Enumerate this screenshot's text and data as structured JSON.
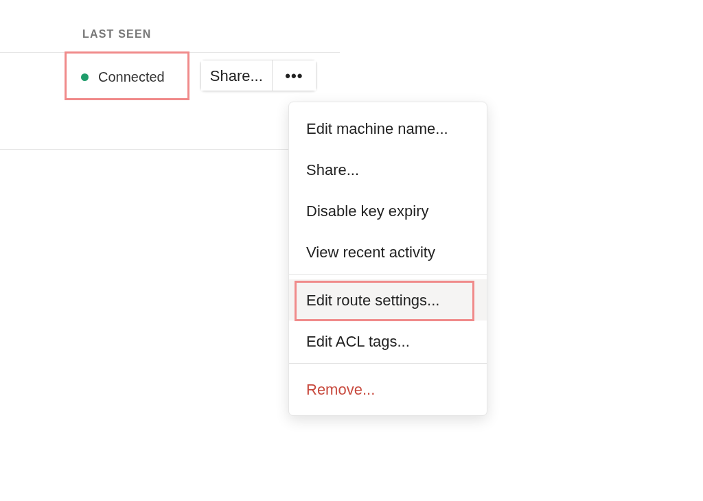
{
  "table": {
    "columns": [
      "LAST SEEN"
    ],
    "rows": [
      {
        "status": {
          "text": "Connected",
          "color": "#1f9d6b",
          "annotated": true
        },
        "share_button": "Share...",
        "more_button": "•••"
      }
    ]
  },
  "menu": {
    "groups": [
      [
        {
          "label": "Edit machine name...",
          "kind": "normal",
          "hovered": false,
          "annotated": false
        },
        {
          "label": "Share...",
          "kind": "normal",
          "hovered": false,
          "annotated": false
        },
        {
          "label": "Disable key expiry",
          "kind": "normal",
          "hovered": false,
          "annotated": false
        },
        {
          "label": "View recent activity",
          "kind": "normal",
          "hovered": false,
          "annotated": false
        }
      ],
      [
        {
          "label": "Edit route settings...",
          "kind": "normal",
          "hovered": true,
          "annotated": true
        },
        {
          "label": "Edit ACL tags...",
          "kind": "normal",
          "hovered": false,
          "annotated": false
        }
      ],
      [
        {
          "label": "Remove...",
          "kind": "danger",
          "hovered": false,
          "annotated": false
        }
      ]
    ]
  }
}
